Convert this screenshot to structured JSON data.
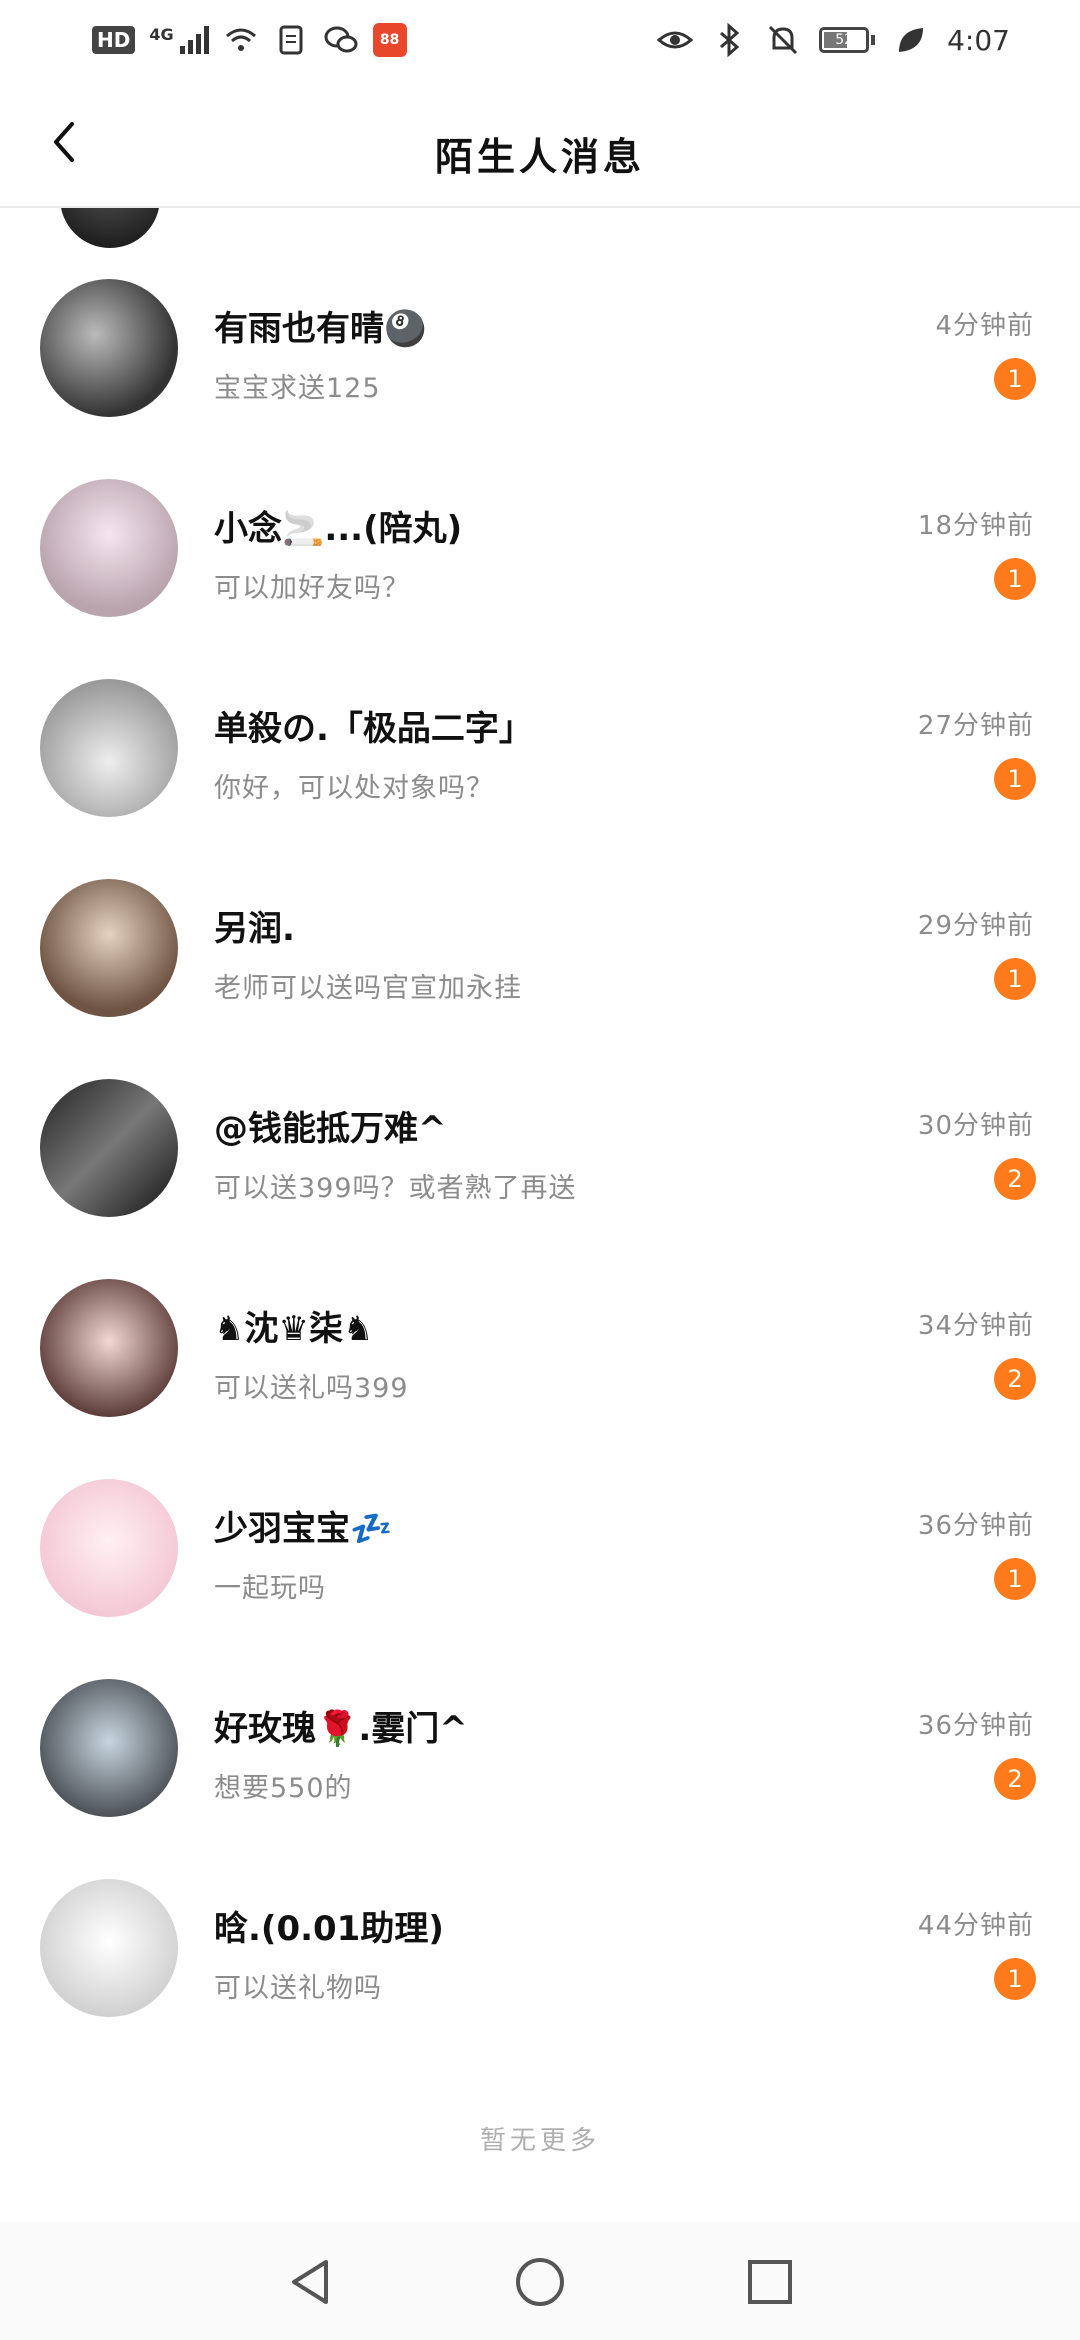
{
  "status_bar": {
    "hd": "HD",
    "network": "4G",
    "battery_level": "52",
    "time": "4:07",
    "app_badge": "88"
  },
  "header": {
    "title": "陌生人消息"
  },
  "conversations": [
    {
      "name": "有雨也有晴🎱",
      "message": "宝宝求送125",
      "time": "4分钟前",
      "unread": "1"
    },
    {
      "name": "小念🚬...(陪丸)",
      "message": "可以加好友吗？",
      "time": "18分钟前",
      "unread": "1"
    },
    {
      "name": "单殺の.「极品二字」",
      "message": "你好，可以处对象吗？",
      "time": "27分钟前",
      "unread": "1"
    },
    {
      "name": "另润.",
      "message": "老师可以送吗官宣加永挂",
      "time": "29分钟前",
      "unread": "1"
    },
    {
      "name": "@钱能抵万难^",
      "message": "可以送399吗？或者熟了再送",
      "time": "30分钟前",
      "unread": "2"
    },
    {
      "name": "♞沈♛柒♞",
      "message": "可以送礼吗399",
      "time": "34分钟前",
      "unread": "2"
    },
    {
      "name": "少羽宝宝💤",
      "message": "一起玩吗",
      "time": "36分钟前",
      "unread": "1"
    },
    {
      "name": "好玫瑰🌹.霎门^",
      "message": "想要550的",
      "time": "36分钟前",
      "unread": "2"
    },
    {
      "name": "晗.(0.01助理)",
      "message": "可以送礼物吗",
      "time": "44分钟前",
      "unread": "1"
    }
  ],
  "footer_note": "暂无更多",
  "colors": {
    "badge": "#ff7a1a",
    "secondary_text": "#8c8c8c"
  }
}
